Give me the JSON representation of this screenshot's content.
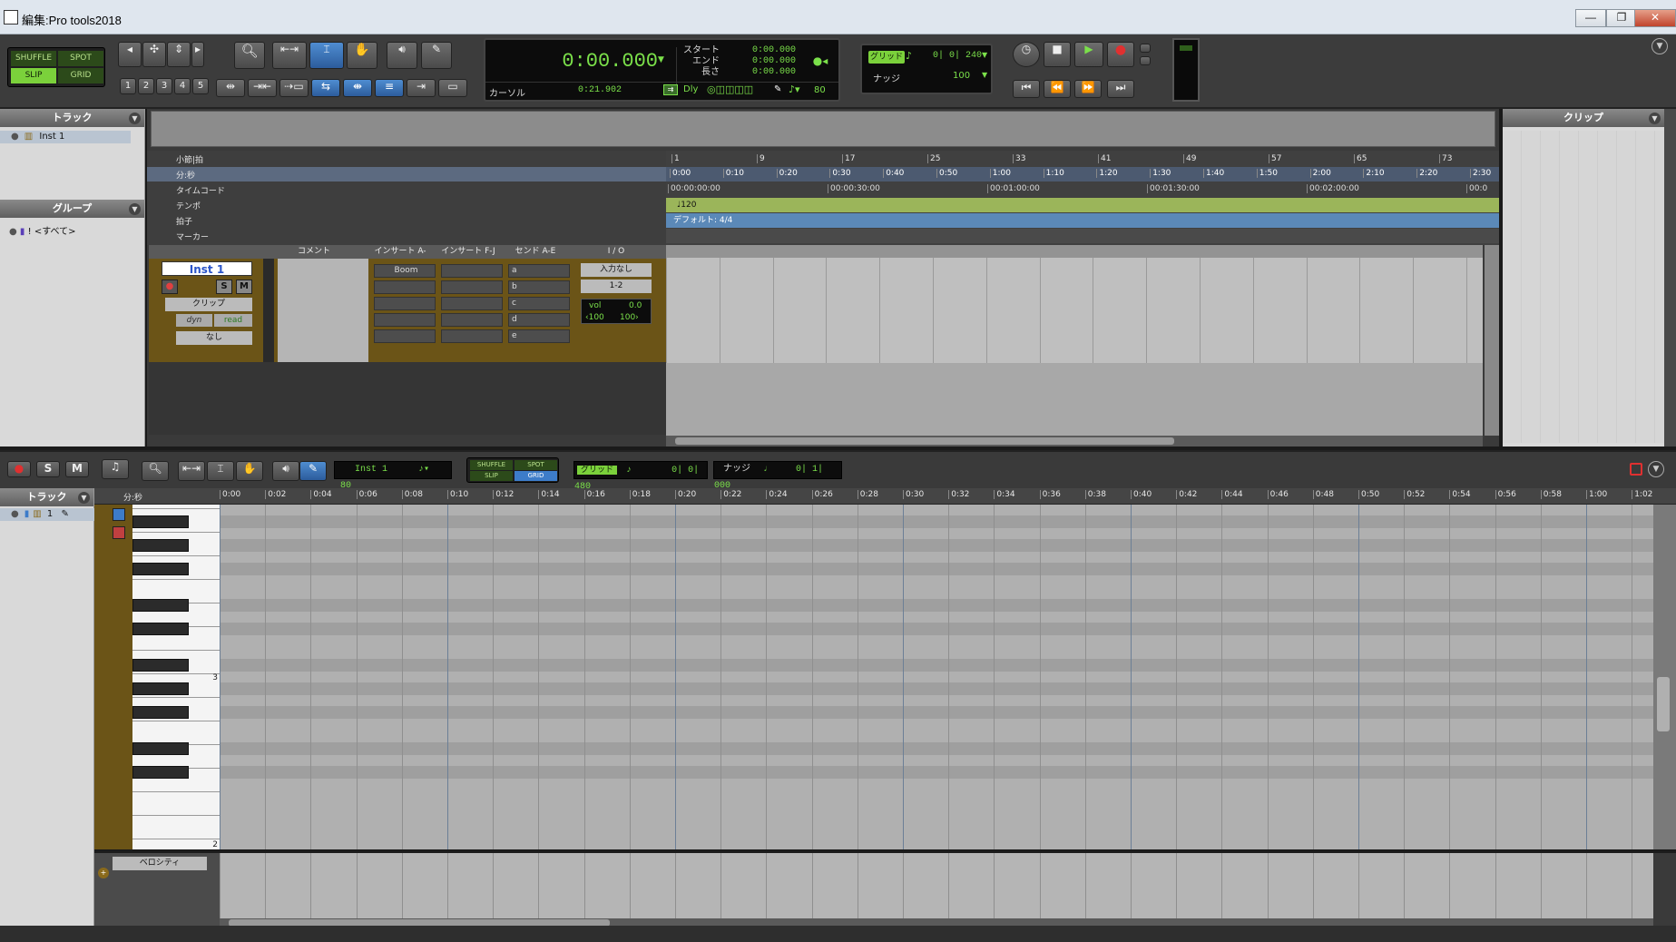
{
  "window": {
    "title": "編集:Pro tools2018",
    "minimize": "—",
    "restore": "❐",
    "close": "✕"
  },
  "modes": {
    "shuffle": "SHUFFLE",
    "spot": "SPOT",
    "slip": "SLIP",
    "grid": "GRID"
  },
  "zoom_presets": [
    "1",
    "2",
    "3",
    "4",
    "5"
  ],
  "counter": {
    "main": "0:00.000",
    "start_label": "スタート",
    "end_label": "エンド",
    "length_label": "長さ",
    "start": "0:00.000",
    "end": "0:00.000",
    "length": "0:00.000",
    "cursor_label": "カーソル",
    "cursor": "0:21.902",
    "dly": "Dly",
    "tempo": "80"
  },
  "grid_nudge": {
    "grid_label": "グリッド",
    "grid_value": "0| 0| 240",
    "nudge_label": "ナッジ",
    "nudge_value": "100"
  },
  "edit_window": {
    "tracks_header": "トラック",
    "track_list": [
      {
        "name": "Inst 1"
      }
    ],
    "groups_header": "グループ",
    "groups": [
      {
        "name": "<すべて>"
      }
    ],
    "clips_header": "クリップ",
    "rulers": {
      "bars_beats": "小節|拍",
      "min_sec": "分:秒",
      "timecode": "タイムコード",
      "tempo": "テンポ",
      "meter": "拍子",
      "markers": "マーカー"
    },
    "bar_ticks": [
      "1",
      "9",
      "17",
      "25",
      "33",
      "41",
      "49",
      "57",
      "65",
      "73"
    ],
    "minsec_ticks": [
      "0:00",
      "0:10",
      "0:20",
      "0:30",
      "0:40",
      "0:50",
      "1:00",
      "1:10",
      "1:20",
      "1:30",
      "1:40",
      "1:50",
      "2:00",
      "2:10",
      "2:20",
      "2:30"
    ],
    "timecode_ticks": [
      "00:00:00:00",
      "00:00:30:00",
      "00:01:00:00",
      "00:01:30:00",
      "00:02:00:00",
      "00:0"
    ],
    "tempo_value": "♩120",
    "meter_value": "デフォルト: 4/4",
    "columns": {
      "comments": "コメント",
      "inserts_ae": "インサート A-E",
      "inserts_fj": "インサート F-J",
      "sends_ae": "センド A-E",
      "io": "I / O"
    },
    "track": {
      "name": "Inst 1",
      "view": "クリップ",
      "automation_mode": "read",
      "dyn": "dyn",
      "none": "なし",
      "insert1": "Boom",
      "sends": [
        "a",
        "b",
        "c",
        "d",
        "e"
      ],
      "input": "入力なし",
      "output": "1-2",
      "vol_label": "vol",
      "vol_value": "0.0",
      "pan_left": "‹100",
      "pan_right": "100›"
    }
  },
  "midi_editor": {
    "instrument": "Inst 1",
    "tempo": "80",
    "grid_label": "グリッド",
    "grid_value": "0| 0| 480",
    "nudge_label": "ナッジ",
    "nudge_value": "0| 1| 000",
    "tracks_header": "トラック",
    "track_row": "1",
    "ruler_label": "分:秒",
    "ticks": [
      "0:00",
      "0:02",
      "0:04",
      "0:06",
      "0:08",
      "0:10",
      "0:12",
      "0:14",
      "0:16",
      "0:18",
      "0:20",
      "0:22",
      "0:24",
      "0:26",
      "0:28",
      "0:30",
      "0:32",
      "0:34",
      "0:36",
      "0:38",
      "0:40",
      "0:42",
      "0:44",
      "0:46",
      "0:48",
      "0:50",
      "0:52",
      "0:54",
      "0:56",
      "0:58",
      "1:00",
      "1:02"
    ],
    "octave_labels": [
      "3",
      "2"
    ],
    "velocity_label": "ベロシティ"
  },
  "colors": {
    "accent_green": "#7be04a",
    "selection_blue": "#3d7cc9",
    "tempo_ruler": "#9bb55a",
    "meter_ruler": "#5b89b8",
    "track_brown": "#8a6a1c"
  }
}
